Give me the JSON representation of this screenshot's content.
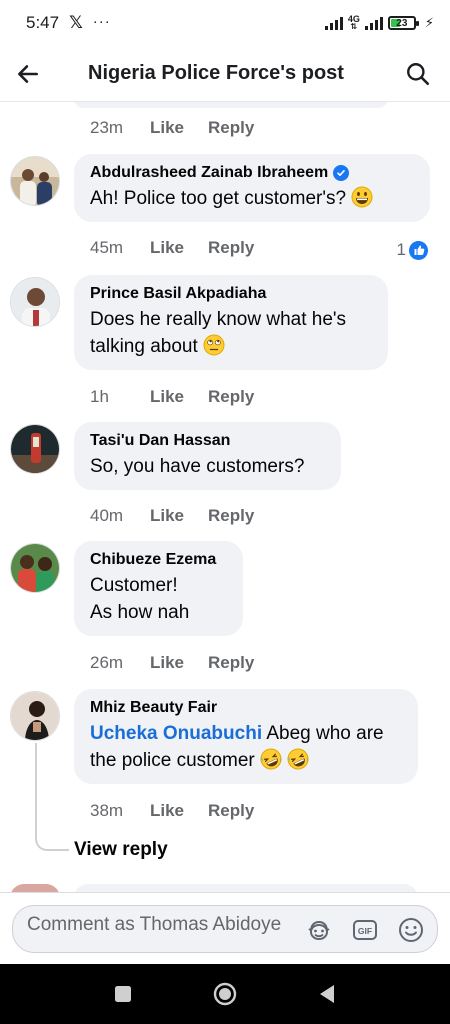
{
  "status_bar": {
    "time": "5:47",
    "x_glyph": "𝕏",
    "more": "···",
    "network": "4G",
    "battery": "23",
    "charging_glyph": "⚡"
  },
  "header": {
    "back_icon": "arrow-left-icon",
    "title": "Nigeria Police Force's post",
    "search_icon": "search-icon"
  },
  "previous_comment_meta": {
    "time": "23m",
    "like": "Like",
    "reply": "Reply"
  },
  "comments": [
    {
      "author": "Abdulrasheed Zainab Ibraheem",
      "verified": true,
      "text": "Ah! Police too get  customer's?",
      "emoji": "grinning-face",
      "time": "45m",
      "like": "Like",
      "reply": "Reply",
      "reaction_count": "1"
    },
    {
      "author": "Prince Basil Akpadiaha",
      "line1": "Does he really know what he's",
      "line2": "talking about",
      "emoji": "face-with-rolling-eyes",
      "time": "1h",
      "like": "Like",
      "reply": "Reply"
    },
    {
      "author": "Tasi'u Dan Hassan",
      "text": "So, you have customers?",
      "time": "40m",
      "like": "Like",
      "reply": "Reply"
    },
    {
      "author": "Chibueze Ezema",
      "line1": "Customer!",
      "line2": "As how nah",
      "time": "26m",
      "like": "Like",
      "reply": "Reply"
    },
    {
      "author": "Mhiz Beauty Fair",
      "mention": "Ucheka Onuabuchi",
      "line1_rest": " Abeg who are",
      "line2": "the police customer",
      "emoji": "rolling-on-floor-laughing",
      "time": "38m",
      "like": "Like",
      "reply": "Reply",
      "view_reply": "View reply"
    }
  ],
  "composer": {
    "placeholder": "Comment as Thomas Abidoye",
    "icons": [
      "avatar-sticker-icon",
      "gif-icon",
      "emoji-icon"
    ],
    "gif_label": "GIF"
  },
  "nav_bar": {
    "icons": [
      "recents-square-icon",
      "home-circle-icon",
      "back-triangle-icon"
    ]
  },
  "colors": {
    "bubble": "#f0f2f5",
    "accent_blue": "#1877f2",
    "mention_blue": "#1a6ed8",
    "secondary_text": "#65676b",
    "battery_green": "#35c24b"
  }
}
